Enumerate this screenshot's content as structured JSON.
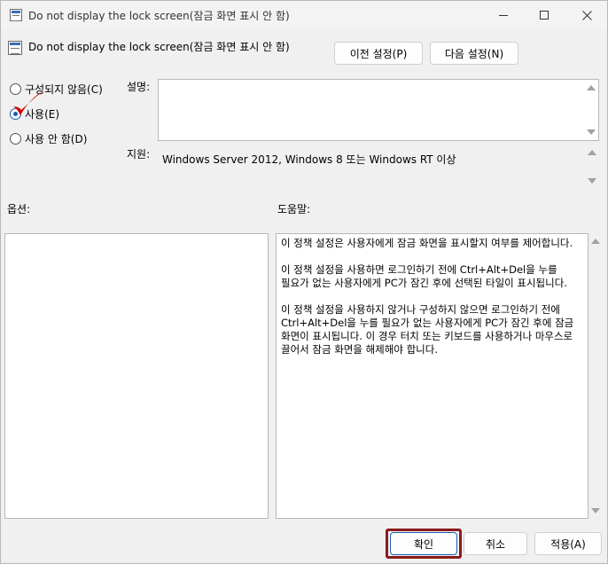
{
  "window": {
    "title": "Do not display the lock screen(잠금 화면 표시 안 함)"
  },
  "header": {
    "policy_title": "Do not display the lock screen(잠금 화면 표시 안 함)",
    "prev_button": "이전 설정(P)",
    "next_button": "다음 설정(N)"
  },
  "state": {
    "options": [
      {
        "label": "구성되지 않음(C)",
        "checked": false
      },
      {
        "label": "사용(E)",
        "checked": true
      },
      {
        "label": "사용 안 함(D)",
        "checked": false
      }
    ]
  },
  "labels": {
    "description": "설명:",
    "supported_on": "지원:",
    "options": "옵션:",
    "help": "도움말:"
  },
  "supported_on_text": "Windows Server 2012, Windows 8 또는 Windows RT 이상",
  "help_text": [
    "이 정책 설정은 사용자에게 잠금 화면을 표시할지 여부를 제어합니다.",
    "이 정책 설정을 사용하면 로그인하기 전에 Ctrl+Alt+Del을 누를 필요가 없는 사용자에게 PC가 잠긴 후에 선택된 타일이 표시됩니다.",
    "이 정책 설정을 사용하지 않거나 구성하지 않으면 로그인하기 전에 Ctrl+Alt+Del을 누를 필요가 없는 사용자에게 PC가 잠긴 후에 잠금 화면이 표시됩니다. 이 경우 터치 또는 키보드를 사용하거나 마우스로 끌어서 잠금 화면을 해제해야 합니다."
  ],
  "footer": {
    "ok": "확인",
    "cancel": "취소",
    "apply": "적용(A)"
  },
  "colors": {
    "highlight_frame": "#8b1a1a",
    "annotation_check": "#d40000",
    "accent": "#1a5fb4"
  }
}
